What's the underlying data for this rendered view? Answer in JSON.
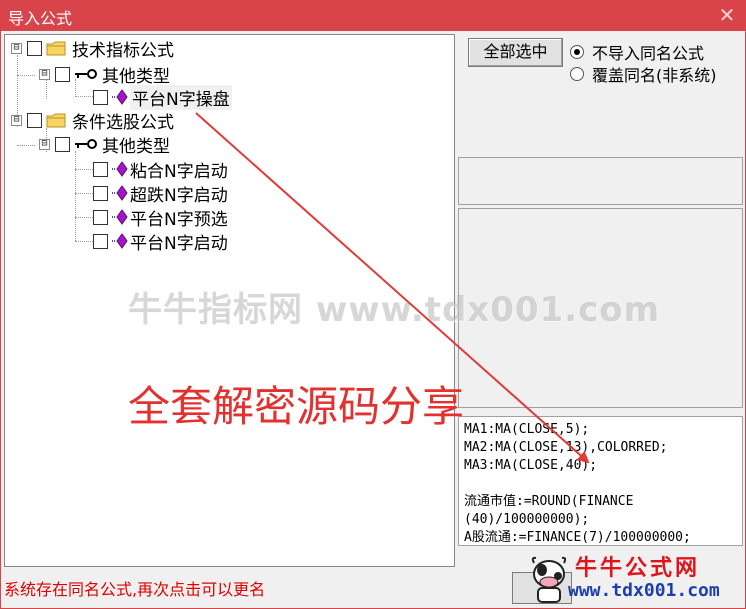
{
  "window": {
    "title": "导入公式",
    "close_glyph": "✕"
  },
  "tree": {
    "nodes": [
      {
        "label": "技术指标公式",
        "expander": "⊟"
      },
      {
        "label": "其他类型",
        "expander": "⊟"
      },
      {
        "label": "平台N字操盘"
      },
      {
        "label": "条件选股公式",
        "expander": "⊟"
      },
      {
        "label": "其他类型",
        "expander": "⊟"
      },
      {
        "label": "粘合N字启动"
      },
      {
        "label": "超跌N字启动"
      },
      {
        "label": "平台N字预选"
      },
      {
        "label": "平台N字启动"
      }
    ]
  },
  "options": {
    "select_all_label": "全部选中",
    "radio_no_import": "不导入同名公式",
    "radio_overwrite": "覆盖同名(非系统)",
    "selected": "no_import"
  },
  "code": {
    "lines": [
      "MA1:MA(CLOSE,5);",
      "MA2:MA(CLOSE,13),COLORRED;",
      "MA3:MA(CLOSE,40);",
      "",
      "流通市值:=ROUND(FINANCE",
      "(40)/100000000);",
      "A股流通:=FINANCE(7)/100000000;"
    ]
  },
  "status": {
    "message": "系统存在同名公式,再次点击可以更名"
  },
  "watermark": {
    "site_text": "牛牛指标网 www.tdx001.com",
    "promo_text": "全套解密源码分享"
  },
  "logo": {
    "title": "牛牛公式网",
    "url": "www.tdx001.com"
  },
  "colors": {
    "title_bar": "#d9444b",
    "status_text": "#e00000",
    "promo_text": "#e2312e",
    "arrow": "#e03a3a"
  },
  "icons": {
    "folder": "folder-icon",
    "type": "key-icon",
    "formula": "purple-gem-icon"
  }
}
